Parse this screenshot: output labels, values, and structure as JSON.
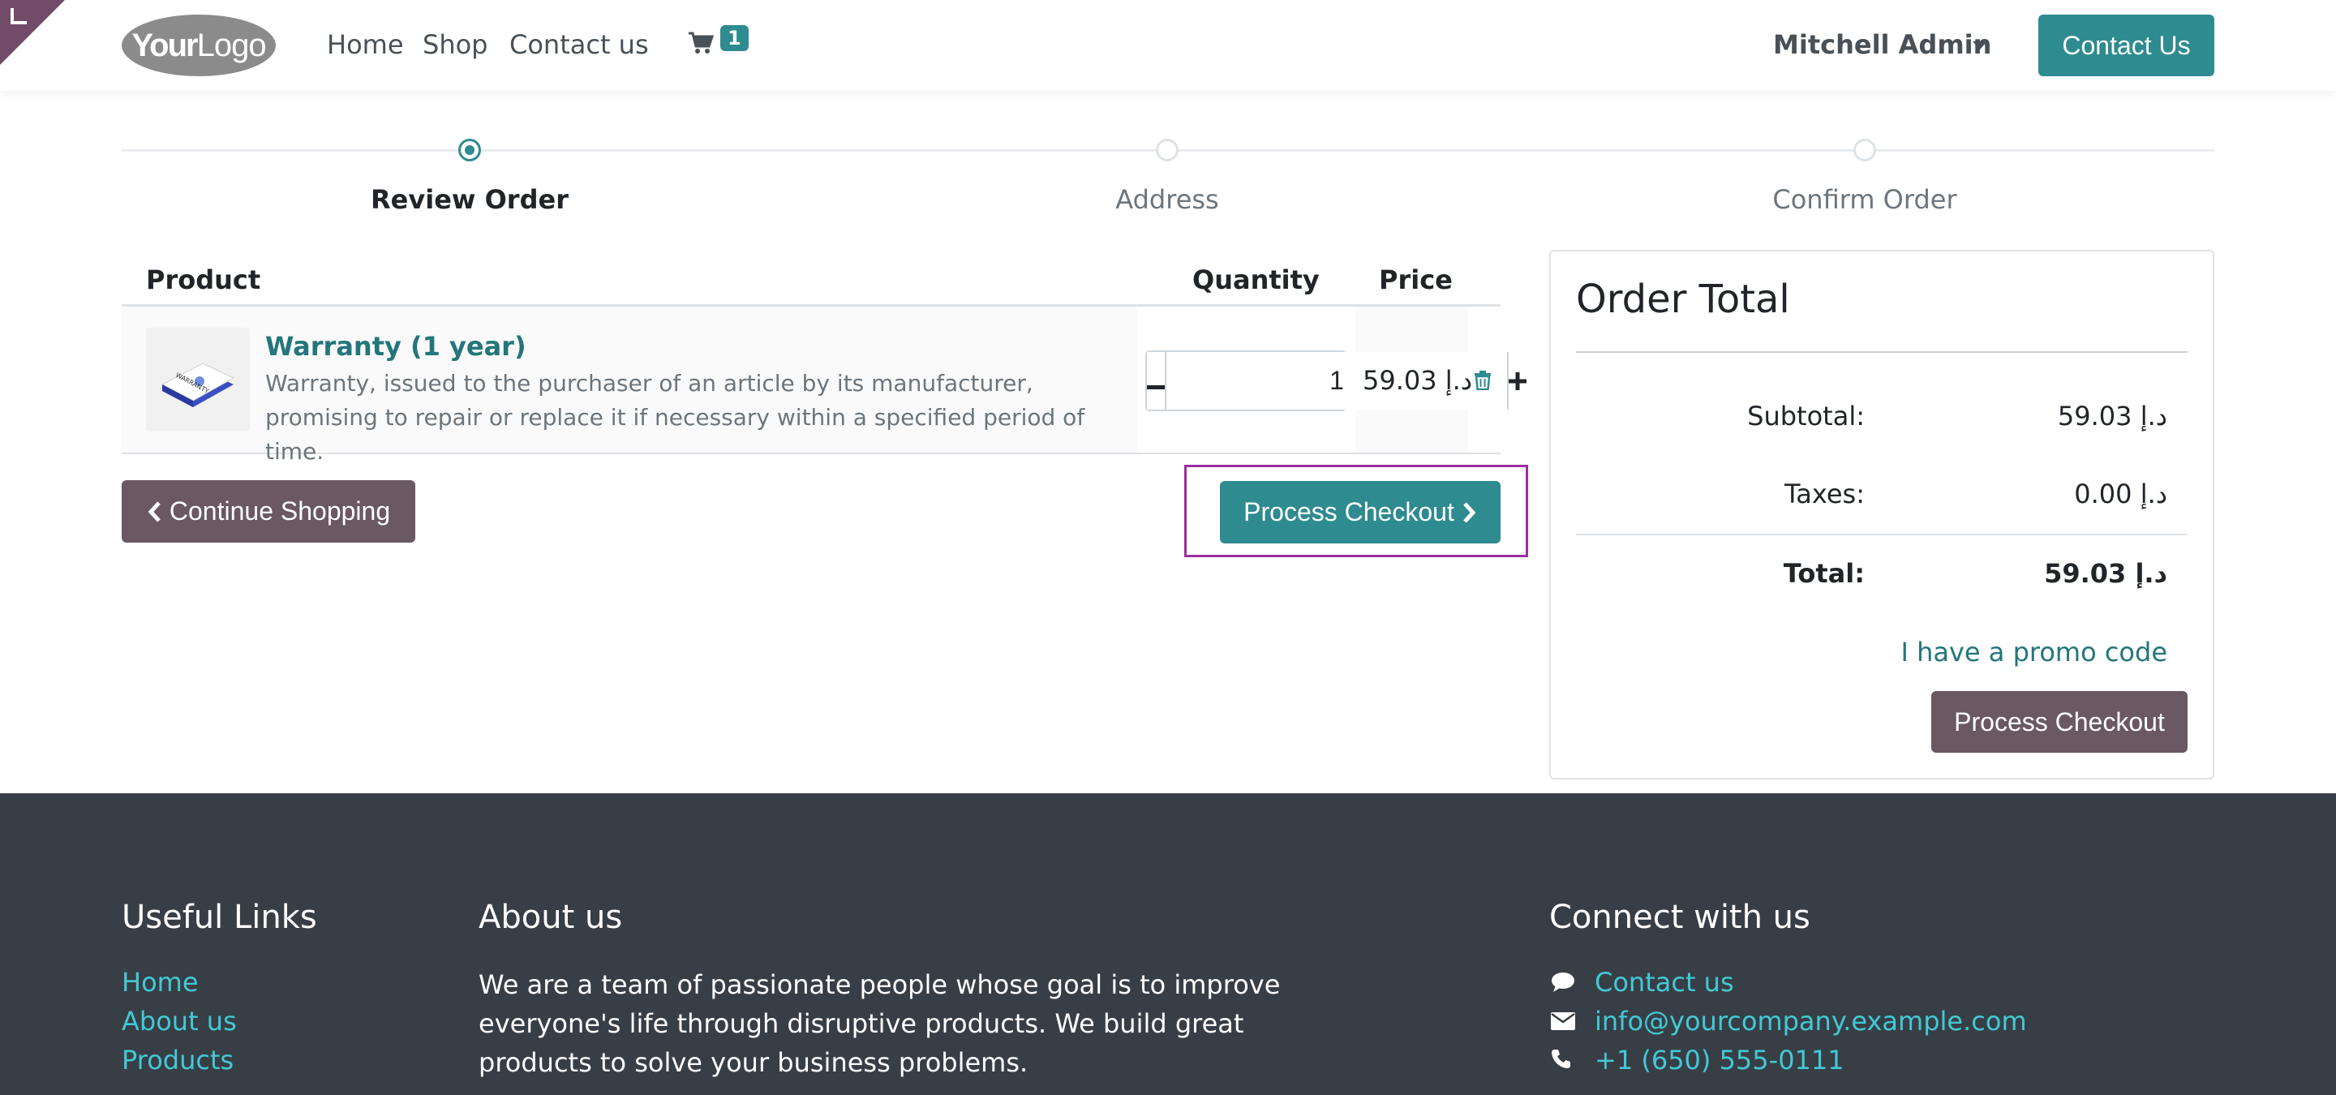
{
  "header": {
    "logo": {
      "bold": "Your",
      "light": "Logo"
    },
    "nav": [
      "Home",
      "Shop",
      "Contact us"
    ],
    "cart_count": "1",
    "user_name": "Mitchell Admin",
    "contact_button": "Contact Us"
  },
  "steps": [
    {
      "label": "Review Order",
      "active": true
    },
    {
      "label": "Address",
      "active": false
    },
    {
      "label": "Confirm Order",
      "active": false
    }
  ],
  "cart": {
    "headers": {
      "product": "Product",
      "quantity": "Quantity",
      "price": "Price"
    },
    "items": [
      {
        "name": "Warranty (1 year)",
        "description": "Warranty, issued to the purchaser of an article by its manufacturer, promising to repair or replace it if necessary within a specified period of time.",
        "quantity": "1",
        "price": "59.03 د.إ"
      }
    ],
    "continue_label": "Continue Shopping",
    "checkout_label": "Process Checkout"
  },
  "order_total": {
    "title": "Order Total",
    "subtotal_label": "Subtotal:",
    "subtotal_value": "59.03 د.إ",
    "taxes_label": "Taxes:",
    "taxes_value": "0.00 د.إ",
    "total_label": "Total:",
    "total_value": "59.03 د.إ",
    "promo_link": "I have a promo code",
    "checkout_label": "Process Checkout"
  },
  "footer": {
    "useful_links_title": "Useful Links",
    "useful_links": [
      "Home",
      "About us",
      "Products"
    ],
    "about_title": "About us",
    "about_text": "We are a team of passionate people whose goal is to improve everyone's life through disruptive products. We build great products to solve your business problems.",
    "connect_title": "Connect with us",
    "connect": {
      "contact": "Contact us",
      "email": "info@yourcompany.example.com",
      "phone": "+1 (650) 555-0111"
    }
  },
  "colors": {
    "teal": "#2e8b90",
    "link_teal": "#23767b",
    "mauve": "#6a5863",
    "footer_bg": "#383e45",
    "footer_link": "#42c9d6",
    "highlight": "#9b2fa0"
  }
}
